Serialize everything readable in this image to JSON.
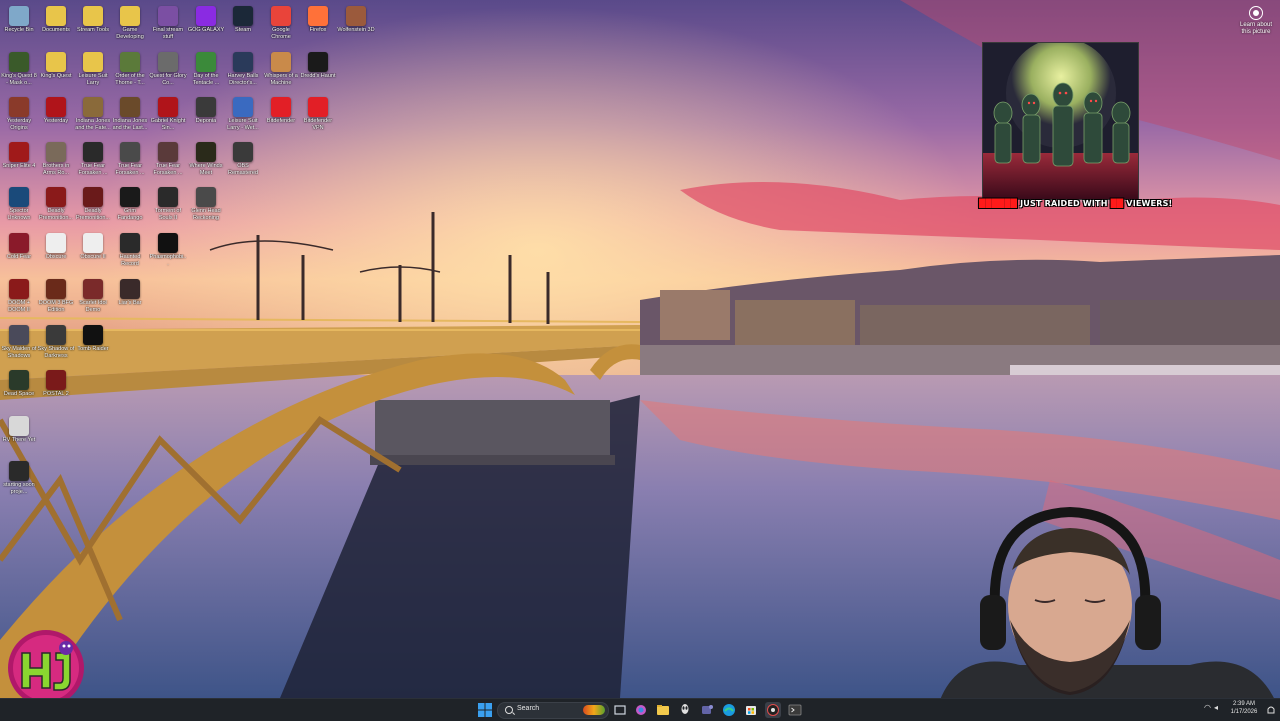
{
  "desktop": {
    "icons": [
      {
        "label": "Recycle Bin",
        "icon": "recycle-bin-icon",
        "color": "#7fa8c9"
      },
      {
        "label": "Documents",
        "icon": "folder-icon",
        "color": "#e8c54a"
      },
      {
        "label": "Stream Tools",
        "icon": "folder-icon",
        "color": "#e8c54a"
      },
      {
        "label": "Game Developing",
        "icon": "folder-icon",
        "color": "#e8c54a"
      },
      {
        "label": "Final stream stuff",
        "icon": "image-icon",
        "color": "#7b4fa3"
      },
      {
        "label": "GOG GALAXY",
        "icon": "gog-galaxy-icon",
        "color": "#8a2be2"
      },
      {
        "label": "Steam",
        "icon": "steam-icon",
        "color": "#1b2838"
      },
      {
        "label": "Google Chrome",
        "icon": "chrome-icon",
        "color": "#e9443a"
      },
      {
        "label": "Firefox",
        "icon": "firefox-icon",
        "color": "#ff7139"
      },
      {
        "label": "Wolfenstein 3D",
        "icon": "wolfenstein-icon",
        "color": "#9b5a3c"
      },
      {
        "label": "King's Quest 8 - Mask o...",
        "icon": "kings-quest-icon",
        "color": "#3a5a2a"
      },
      {
        "label": "King's Quest",
        "icon": "folder-icon",
        "color": "#e8c54a"
      },
      {
        "label": "Leisure Suit Larry",
        "icon": "folder-icon",
        "color": "#e8c54a"
      },
      {
        "label": "Order of the Thorne - T...",
        "icon": "game-icon",
        "color": "#5b7a3a"
      },
      {
        "label": "Quest for Glory Co...",
        "icon": "game-icon",
        "color": "#6b6b6b"
      },
      {
        "label": "Day of the Tentacle ...",
        "icon": "game-icon",
        "color": "#3b8a3a"
      },
      {
        "label": "Harvey Balls Director's...",
        "icon": "game-icon",
        "color": "#2a3a5a"
      },
      {
        "label": "Whispers of a Machine",
        "icon": "game-icon",
        "color": "#c98a4a"
      },
      {
        "label": "Dredd's Haunt",
        "icon": "ghost-icon",
        "color": "#1a1a1a"
      },
      {
        "label": "Yesterday Origins",
        "icon": "game-icon",
        "color": "#8a3a2a"
      },
      {
        "label": "Yesterday",
        "icon": "game-icon",
        "color": "#b0141a"
      },
      {
        "label": "Indiana Jones and the Fate...",
        "icon": "game-icon",
        "color": "#8a6a3a"
      },
      {
        "label": "Indiana Jones and the Last...",
        "icon": "game-icon",
        "color": "#6a4a2a"
      },
      {
        "label": "Gabriel Knight Sin...",
        "icon": "game-icon",
        "color": "#b0141a"
      },
      {
        "label": "Deponia",
        "icon": "deponia-icon",
        "color": "#3a3a3a"
      },
      {
        "label": "Leisure Suit Larry - Wet...",
        "icon": "game-icon",
        "color": "#3a6ac0"
      },
      {
        "label": "Bitdefender",
        "icon": "bitdefender-icon",
        "color": "#e21f26"
      },
      {
        "label": "Bitdefender VPN",
        "icon": "bitdefender-vpn-icon",
        "color": "#e21f26"
      },
      {
        "label": "Sniper Elite 4",
        "icon": "game-icon",
        "color": "#a01a1a"
      },
      {
        "label": "Brothers in Arms Ro...",
        "icon": "game-icon",
        "color": "#7a6a5a"
      },
      {
        "label": "True Fear Forsaken ...",
        "icon": "game-icon",
        "color": "#2a2a2a"
      },
      {
        "label": "True Fear Forsaken ...",
        "icon": "game-icon",
        "color": "#4a4a4a"
      },
      {
        "label": "True Fear Forsaken ...",
        "icon": "game-icon",
        "color": "#5a3a3a"
      },
      {
        "label": "Where Winds Meet",
        "icon": "game-icon",
        "color": "#2a2a1a"
      },
      {
        "label": "OBS Remastered",
        "icon": "obs-icon",
        "color": "#3a3a3a"
      },
      {
        "label": "Spector Unknown",
        "icon": "game-icon",
        "color": "#1a4a7a"
      },
      {
        "label": "Deadly Premonition...",
        "icon": "game-icon",
        "color": "#8a1a1a"
      },
      {
        "label": "Deadly Premonition...",
        "icon": "game-icon",
        "color": "#6a1a1a"
      },
      {
        "label": "Grim Fandango",
        "icon": "game-icon",
        "color": "#1a1a1a"
      },
      {
        "label": "Torment of Souls II",
        "icon": "game-icon",
        "color": "#2a2a2a"
      },
      {
        "label": "Glenn Head Reckoning",
        "icon": "game-icon",
        "color": "#4a4a4a"
      },
      {
        "label": "Cold Fear",
        "icon": "game-icon",
        "color": "#8a1a2a"
      },
      {
        "label": "Obscure",
        "icon": "file-icon",
        "color": "#eeeeee"
      },
      {
        "label": "Obscure II",
        "icon": "file-icon",
        "color": "#eeeeee"
      },
      {
        "label": "Haunted Record",
        "icon": "game-icon",
        "color": "#2a2a2a"
      },
      {
        "label": "Phasmophobi...",
        "icon": "phasmophobia-icon",
        "color": "#111111"
      },
      {
        "label": "DOOM + DOOM II",
        "icon": "doom-icon",
        "color": "#8a1a1a"
      },
      {
        "label": "DOOM 3 BFG Edition",
        "icon": "doom-icon",
        "color": "#6a2a1a"
      },
      {
        "label": "Scarlet Idol Demo",
        "icon": "game-icon",
        "color": "#7a2a2a"
      },
      {
        "label": "Liar's Bar",
        "icon": "game-icon",
        "color": "#3a2a2a"
      },
      {
        "label": "Sky Maiden of Shadows",
        "icon": "game-icon",
        "color": "#4a4a5a"
      },
      {
        "label": "Sky Shadow of Darkness",
        "icon": "game-icon",
        "color": "#3a3a3a"
      },
      {
        "label": "Tomb Raider",
        "icon": "tomb-raider-icon",
        "color": "#111111"
      },
      {
        "label": "Dead Space",
        "icon": "game-icon",
        "color": "#2a3a2a"
      },
      {
        "label": "POSTAL 2",
        "icon": "game-icon",
        "color": "#7a1a1a"
      },
      {
        "label": "RV There Yet",
        "icon": "game-icon",
        "color": "#d8d8d8"
      },
      {
        "label": "starting soon proje...",
        "icon": "file-icon",
        "color": "#2a2a2a"
      }
    ]
  },
  "learn_about": {
    "label": "Learn about this picture",
    "icon": "camera-icon"
  },
  "raid": {
    "caption_red_1": "██████",
    "caption_white_1": " JUST RAIDED WITH ",
    "caption_red_2": "██",
    "caption_white_2": " VIEWERS!"
  },
  "taskbar": {
    "search_placeholder": "Search",
    "clock_time": "2:39 AM",
    "clock_date": "1/17/2026",
    "apps": [
      {
        "name": "start-button",
        "color": "#3aa0f0"
      },
      {
        "name": "task-view",
        "color": "#cfd6de"
      },
      {
        "name": "file-explorer",
        "color": "#f2c94c"
      },
      {
        "name": "copilot",
        "color": "#c45ac8"
      },
      {
        "name": "alienware",
        "color": "#d9d9d9"
      },
      {
        "name": "teams",
        "color": "#6264a7"
      },
      {
        "name": "edge",
        "color": "#1a9be0"
      },
      {
        "name": "microsoft-store",
        "color": "#3a8de0"
      },
      {
        "name": "obs",
        "color": "#e24c4c"
      },
      {
        "name": "terminal",
        "color": "#444444"
      }
    ]
  },
  "colors": {
    "taskbar_bg": "#1f2328",
    "raid_red": "#ff1a1a"
  }
}
